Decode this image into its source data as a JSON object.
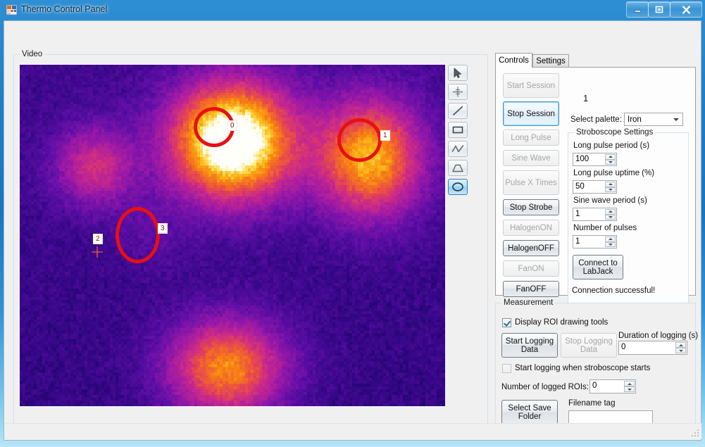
{
  "window": {
    "title": "Thermo Control Panel",
    "icon": "app-icon",
    "minimize": "–",
    "maximize": "❐",
    "close": "✕"
  },
  "video": {
    "group_label": "Video",
    "rois": [
      {
        "id": "0",
        "shape": "ellipse",
        "label": "0"
      },
      {
        "id": "1",
        "shape": "ellipse",
        "label": "1"
      },
      {
        "id": "2",
        "shape": "point",
        "label": "2"
      },
      {
        "id": "3",
        "shape": "ellipse",
        "label": "3"
      }
    ]
  },
  "tools": [
    {
      "name": "pointer-tool",
      "icon": "cursor-arrow-icon",
      "selected": false
    },
    {
      "name": "point-tool",
      "icon": "crosshair-icon",
      "selected": false
    },
    {
      "name": "line-tool",
      "icon": "line-icon",
      "selected": false
    },
    {
      "name": "rectangle-tool",
      "icon": "rectangle-icon",
      "selected": false
    },
    {
      "name": "polyline-tool",
      "icon": "polyline-icon",
      "selected": false
    },
    {
      "name": "polygon-tool",
      "icon": "polygon-icon",
      "selected": false
    },
    {
      "name": "ellipse-tool",
      "icon": "ellipse-icon",
      "selected": true
    }
  ],
  "tabs": [
    {
      "label": "Controls",
      "active": true
    },
    {
      "label": "Settings",
      "active": false
    }
  ],
  "controls": {
    "session_counter": "1",
    "buttons": [
      {
        "label": "Start Session",
        "enabled": false
      },
      {
        "label": "Stop Session",
        "enabled": true,
        "focused": true
      },
      {
        "label": "Long Pulse",
        "enabled": false
      },
      {
        "label": "Sine Wave",
        "enabled": false
      },
      {
        "label": "Pulse X Times",
        "enabled": false
      },
      {
        "label": "Stop Strobe",
        "enabled": true
      },
      {
        "label": "HalogenON",
        "enabled": false
      },
      {
        "label": "HalogenOFF",
        "enabled": true
      },
      {
        "label": "FanON",
        "enabled": false
      },
      {
        "label": "FanOFF",
        "enabled": true
      }
    ],
    "palette_label": "Select palette:",
    "palette_value": "Iron",
    "palette_options": [
      "Iron"
    ],
    "stroboscope": {
      "group_label": "Stroboscope Settings",
      "fields": [
        {
          "label": "Long pulse period (s)",
          "value": "100"
        },
        {
          "label": "Long pulse uptime (%)",
          "value": "50"
        },
        {
          "label": "Sine wave period (s)",
          "value": "1"
        },
        {
          "label": "Number of pulses",
          "value": "1"
        }
      ],
      "connect_button": "Connect to LabJack",
      "connection_status": "Connection successful!"
    }
  },
  "measurement": {
    "group_label": "Measurement",
    "display_roi_label": "Display ROI drawing tools",
    "display_roi_checked": true,
    "start_logging_label": "Start Logging Data",
    "start_logging_enabled": true,
    "stop_logging_label": "Stop Logging Data",
    "stop_logging_enabled": false,
    "duration_label": "Duration of logging (s)",
    "duration_value": "0",
    "autostart_label": "Start logging when stroboscope starts",
    "autostart_checked": false,
    "roi_count_label": "Number of logged ROIs:",
    "roi_count_value": "0",
    "select_folder_label": "Select Save Folder",
    "filename_tag_label": "Filename tag",
    "filename_tag_value": ""
  },
  "colors": {
    "accent": "#1876c0",
    "roi": "#e81010",
    "focus": "#3c9ad8",
    "face": "#f0f0f0"
  }
}
